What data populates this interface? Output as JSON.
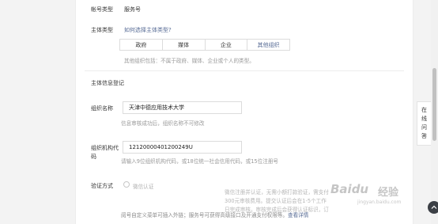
{
  "account_type": {
    "label": "帐号类型",
    "value": "服务号"
  },
  "subject_type": {
    "label": "主体类型",
    "help_link": "如何选择主体类型?",
    "options": [
      "政府",
      "媒体",
      "企业",
      "其他组织"
    ],
    "selected": "其他组织",
    "note": "其他组织包括：不属于政府、媒体、企业或个人的类型。"
  },
  "section_title": "主体信息登记",
  "org_name": {
    "label": "组织名称",
    "value": "天津中德应用技术大学",
    "hint": "信息审核成功后，组织名称不可修改"
  },
  "org_code": {
    "label_line1": "组织机构代",
    "label_line2": "码",
    "value": "12120000401200249U",
    "hint": "请输入9位组织机构代码，或18位统一社会信用代码，或15位注册号"
  },
  "verify": {
    "label": "验证方式",
    "option": "微信认证",
    "popover_lines": [
      "微信注册并认证，无需小额打款验证，需支付",
      "300元审核费用。提交认证后会在1-5个工作",
      "日完成审核。审核完成后会获得认证标识，订"
    ],
    "bottom_text": "阅号自定义菜单可插入外链；服务号可获得高级接口及开通支付权限等。",
    "details_link": "查看详情"
  },
  "side_tab": [
    "在",
    "线",
    "问",
    "答"
  ],
  "watermark": {
    "brand": "Baidu",
    "cn": "经验",
    "url": "jingyan.baidu.com"
  },
  "colors": {
    "link": "#576b95",
    "hint": "#9a9a9a",
    "border": "#dcdcdc"
  }
}
